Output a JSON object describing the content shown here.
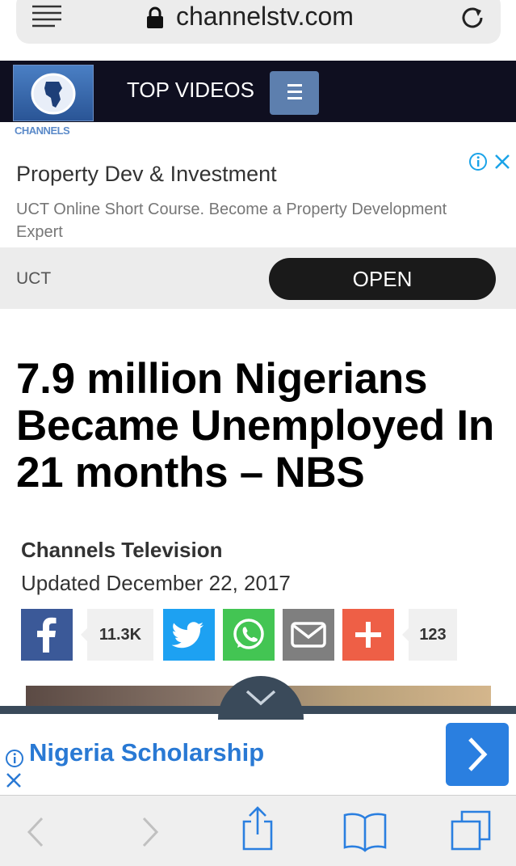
{
  "browser": {
    "url": "channelstv.com",
    "icons": [
      "reader-icon",
      "lock-icon",
      "reload-icon"
    ]
  },
  "site_header": {
    "logo_label": "CHANNELS",
    "nav_label": "TOP VIDEOS",
    "menu_icon": "hamburger-icon"
  },
  "ad": {
    "title": "Property Dev & Investment",
    "description": "UCT Online Short Course. Become a Property Development Expert",
    "advertiser": "UCT",
    "cta": "OPEN",
    "icons": [
      "info-icon",
      "close-icon"
    ]
  },
  "article": {
    "headline": "7.9 million Nigerians Became Unemployed In 21 months – NBS",
    "author": "Channels Television",
    "updated": "Updated December 22, 2017"
  },
  "share": {
    "facebook_count": "11.3K",
    "total_count": "123",
    "icons": [
      "facebook-icon",
      "twitter-icon",
      "whatsapp-icon",
      "email-icon",
      "plus-icon"
    ],
    "colors": {
      "facebook": "#3b5998",
      "twitter": "#1da1f2",
      "whatsapp": "#43c553",
      "email": "#7f7f7f",
      "plus": "#ee5f46"
    }
  },
  "bottom_ad": {
    "text": "Nigeria Scholarship",
    "accent": "#2a7fe0"
  },
  "toolbar": {
    "icons": [
      "back-icon",
      "forward-icon",
      "share-icon",
      "bookmarks-icon",
      "tabs-icon"
    ]
  }
}
